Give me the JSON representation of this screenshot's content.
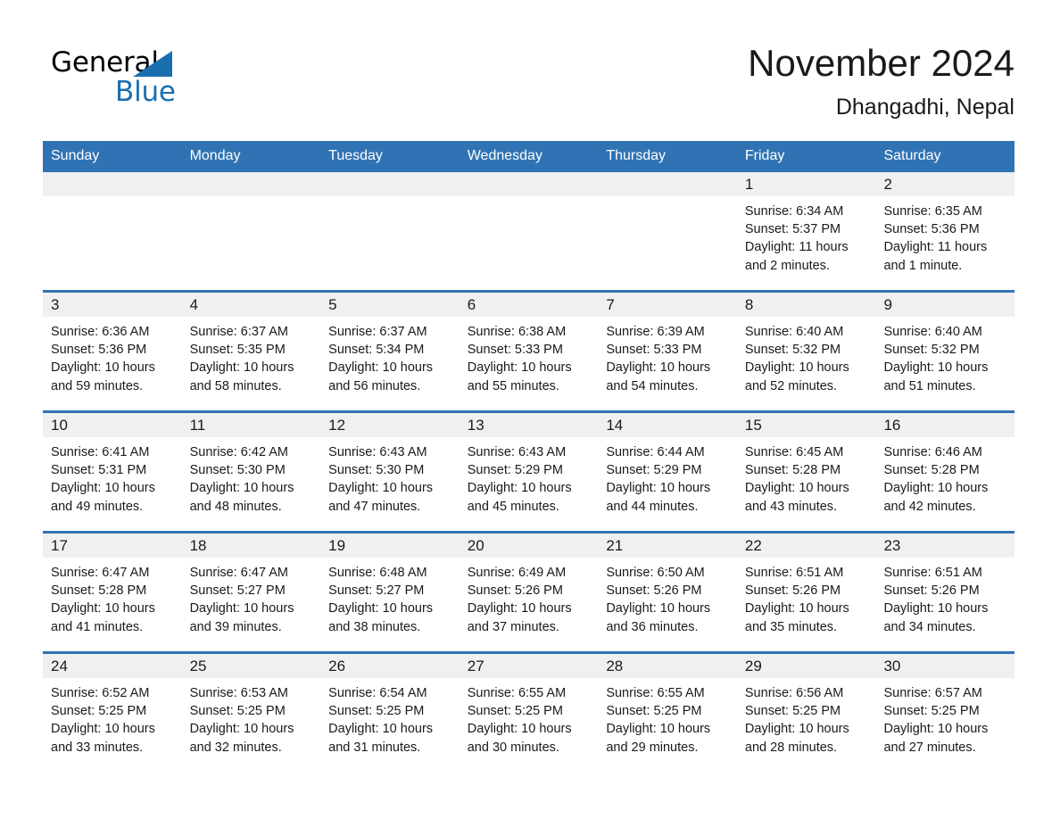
{
  "brand": {
    "logo_text_1": "General",
    "logo_text_2": "Blue",
    "logo_icon": "triangle-flag-icon",
    "accent_color": "#1a6faf"
  },
  "header": {
    "title": "November 2024",
    "subtitle": "Dhangadhi, Nepal"
  },
  "calendar": {
    "header_bg": "#3073b4",
    "day_band_bg": "#f0f0f0",
    "weekday_names": [
      "Sunday",
      "Monday",
      "Tuesday",
      "Wednesday",
      "Thursday",
      "Friday",
      "Saturday"
    ],
    "weeks": [
      [
        {
          "day": "",
          "empty": true
        },
        {
          "day": "",
          "empty": true
        },
        {
          "day": "",
          "empty": true
        },
        {
          "day": "",
          "empty": true
        },
        {
          "day": "",
          "empty": true
        },
        {
          "day": "1",
          "sunrise": "Sunrise: 6:34 AM",
          "sunset": "Sunset: 5:37 PM",
          "daylight_line1": "Daylight: 11 hours",
          "daylight_line2": "and 2 minutes."
        },
        {
          "day": "2",
          "sunrise": "Sunrise: 6:35 AM",
          "sunset": "Sunset: 5:36 PM",
          "daylight_line1": "Daylight: 11 hours",
          "daylight_line2": "and 1 minute."
        }
      ],
      [
        {
          "day": "3",
          "sunrise": "Sunrise: 6:36 AM",
          "sunset": "Sunset: 5:36 PM",
          "daylight_line1": "Daylight: 10 hours",
          "daylight_line2": "and 59 minutes."
        },
        {
          "day": "4",
          "sunrise": "Sunrise: 6:37 AM",
          "sunset": "Sunset: 5:35 PM",
          "daylight_line1": "Daylight: 10 hours",
          "daylight_line2": "and 58 minutes."
        },
        {
          "day": "5",
          "sunrise": "Sunrise: 6:37 AM",
          "sunset": "Sunset: 5:34 PM",
          "daylight_line1": "Daylight: 10 hours",
          "daylight_line2": "and 56 minutes."
        },
        {
          "day": "6",
          "sunrise": "Sunrise: 6:38 AM",
          "sunset": "Sunset: 5:33 PM",
          "daylight_line1": "Daylight: 10 hours",
          "daylight_line2": "and 55 minutes."
        },
        {
          "day": "7",
          "sunrise": "Sunrise: 6:39 AM",
          "sunset": "Sunset: 5:33 PM",
          "daylight_line1": "Daylight: 10 hours",
          "daylight_line2": "and 54 minutes."
        },
        {
          "day": "8",
          "sunrise": "Sunrise: 6:40 AM",
          "sunset": "Sunset: 5:32 PM",
          "daylight_line1": "Daylight: 10 hours",
          "daylight_line2": "and 52 minutes."
        },
        {
          "day": "9",
          "sunrise": "Sunrise: 6:40 AM",
          "sunset": "Sunset: 5:32 PM",
          "daylight_line1": "Daylight: 10 hours",
          "daylight_line2": "and 51 minutes."
        }
      ],
      [
        {
          "day": "10",
          "sunrise": "Sunrise: 6:41 AM",
          "sunset": "Sunset: 5:31 PM",
          "daylight_line1": "Daylight: 10 hours",
          "daylight_line2": "and 49 minutes."
        },
        {
          "day": "11",
          "sunrise": "Sunrise: 6:42 AM",
          "sunset": "Sunset: 5:30 PM",
          "daylight_line1": "Daylight: 10 hours",
          "daylight_line2": "and 48 minutes."
        },
        {
          "day": "12",
          "sunrise": "Sunrise: 6:43 AM",
          "sunset": "Sunset: 5:30 PM",
          "daylight_line1": "Daylight: 10 hours",
          "daylight_line2": "and 47 minutes."
        },
        {
          "day": "13",
          "sunrise": "Sunrise: 6:43 AM",
          "sunset": "Sunset: 5:29 PM",
          "daylight_line1": "Daylight: 10 hours",
          "daylight_line2": "and 45 minutes."
        },
        {
          "day": "14",
          "sunrise": "Sunrise: 6:44 AM",
          "sunset": "Sunset: 5:29 PM",
          "daylight_line1": "Daylight: 10 hours",
          "daylight_line2": "and 44 minutes."
        },
        {
          "day": "15",
          "sunrise": "Sunrise: 6:45 AM",
          "sunset": "Sunset: 5:28 PM",
          "daylight_line1": "Daylight: 10 hours",
          "daylight_line2": "and 43 minutes."
        },
        {
          "day": "16",
          "sunrise": "Sunrise: 6:46 AM",
          "sunset": "Sunset: 5:28 PM",
          "daylight_line1": "Daylight: 10 hours",
          "daylight_line2": "and 42 minutes."
        }
      ],
      [
        {
          "day": "17",
          "sunrise": "Sunrise: 6:47 AM",
          "sunset": "Sunset: 5:28 PM",
          "daylight_line1": "Daylight: 10 hours",
          "daylight_line2": "and 41 minutes."
        },
        {
          "day": "18",
          "sunrise": "Sunrise: 6:47 AM",
          "sunset": "Sunset: 5:27 PM",
          "daylight_line1": "Daylight: 10 hours",
          "daylight_line2": "and 39 minutes."
        },
        {
          "day": "19",
          "sunrise": "Sunrise: 6:48 AM",
          "sunset": "Sunset: 5:27 PM",
          "daylight_line1": "Daylight: 10 hours",
          "daylight_line2": "and 38 minutes."
        },
        {
          "day": "20",
          "sunrise": "Sunrise: 6:49 AM",
          "sunset": "Sunset: 5:26 PM",
          "daylight_line1": "Daylight: 10 hours",
          "daylight_line2": "and 37 minutes."
        },
        {
          "day": "21",
          "sunrise": "Sunrise: 6:50 AM",
          "sunset": "Sunset: 5:26 PM",
          "daylight_line1": "Daylight: 10 hours",
          "daylight_line2": "and 36 minutes."
        },
        {
          "day": "22",
          "sunrise": "Sunrise: 6:51 AM",
          "sunset": "Sunset: 5:26 PM",
          "daylight_line1": "Daylight: 10 hours",
          "daylight_line2": "and 35 minutes."
        },
        {
          "day": "23",
          "sunrise": "Sunrise: 6:51 AM",
          "sunset": "Sunset: 5:26 PM",
          "daylight_line1": "Daylight: 10 hours",
          "daylight_line2": "and 34 minutes."
        }
      ],
      [
        {
          "day": "24",
          "sunrise": "Sunrise: 6:52 AM",
          "sunset": "Sunset: 5:25 PM",
          "daylight_line1": "Daylight: 10 hours",
          "daylight_line2": "and 33 minutes."
        },
        {
          "day": "25",
          "sunrise": "Sunrise: 6:53 AM",
          "sunset": "Sunset: 5:25 PM",
          "daylight_line1": "Daylight: 10 hours",
          "daylight_line2": "and 32 minutes."
        },
        {
          "day": "26",
          "sunrise": "Sunrise: 6:54 AM",
          "sunset": "Sunset: 5:25 PM",
          "daylight_line1": "Daylight: 10 hours",
          "daylight_line2": "and 31 minutes."
        },
        {
          "day": "27",
          "sunrise": "Sunrise: 6:55 AM",
          "sunset": "Sunset: 5:25 PM",
          "daylight_line1": "Daylight: 10 hours",
          "daylight_line2": "and 30 minutes."
        },
        {
          "day": "28",
          "sunrise": "Sunrise: 6:55 AM",
          "sunset": "Sunset: 5:25 PM",
          "daylight_line1": "Daylight: 10 hours",
          "daylight_line2": "and 29 minutes."
        },
        {
          "day": "29",
          "sunrise": "Sunrise: 6:56 AM",
          "sunset": "Sunset: 5:25 PM",
          "daylight_line1": "Daylight: 10 hours",
          "daylight_line2": "and 28 minutes."
        },
        {
          "day": "30",
          "sunrise": "Sunrise: 6:57 AM",
          "sunset": "Sunset: 5:25 PM",
          "daylight_line1": "Daylight: 10 hours",
          "daylight_line2": "and 27 minutes."
        }
      ]
    ]
  }
}
